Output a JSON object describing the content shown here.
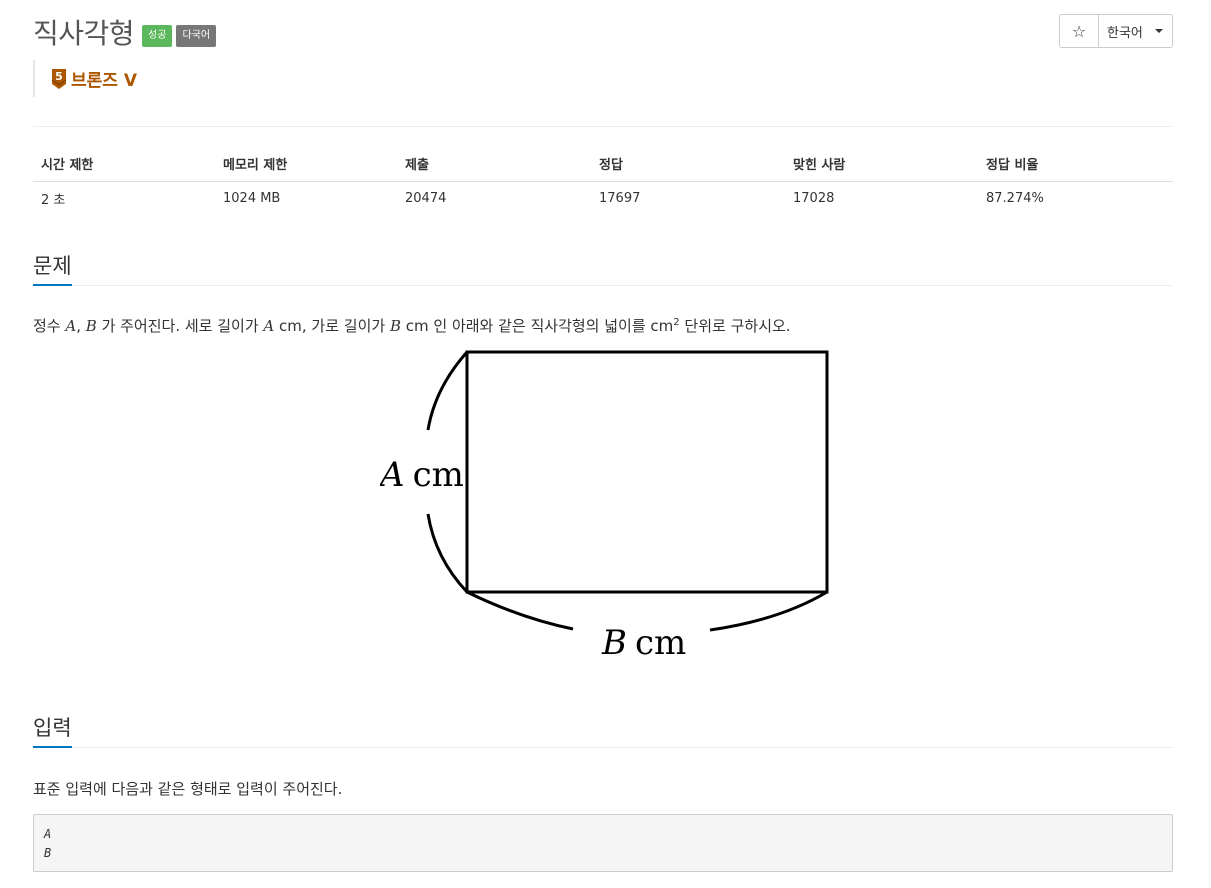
{
  "header": {
    "title": "직사각형",
    "badge_success": "성공",
    "badge_lang": "다국어",
    "tier": "브론즈 V",
    "tier_level": "5",
    "lang_button": "한국어",
    "star_icon": "☆"
  },
  "info": {
    "headers": [
      "시간 제한",
      "메모리 제한",
      "제출",
      "정답",
      "맞힌 사람",
      "정답 비율"
    ],
    "values": [
      "2 초",
      "1024 MB",
      "20474",
      "17697",
      "17028",
      "87.274%"
    ]
  },
  "problem": {
    "section_title": "문제",
    "text_parts": [
      "정수 ",
      "A",
      ", ",
      "B",
      " 가 주어진다. 세로 길이가 ",
      "A",
      " cm, 가로 길이가 ",
      "B",
      " cm 인 아래와 같은 직사각형의 넓이를 cm",
      "2",
      " 단위로 구하시오."
    ],
    "figure": {
      "label_a_var": "A",
      "label_a_unit": "cm",
      "label_b_var": "B",
      "label_b_unit": "cm"
    }
  },
  "input": {
    "section_title": "입력",
    "description": "표준 입력에 다음과 같은 형태로 입력이 주어진다.",
    "sample_lines": [
      "A",
      "B"
    ]
  },
  "colors": {
    "success": "#5cb85c",
    "lang_badge": "#777777",
    "tier": "#ad5600",
    "section_underline": "#0076c0"
  }
}
